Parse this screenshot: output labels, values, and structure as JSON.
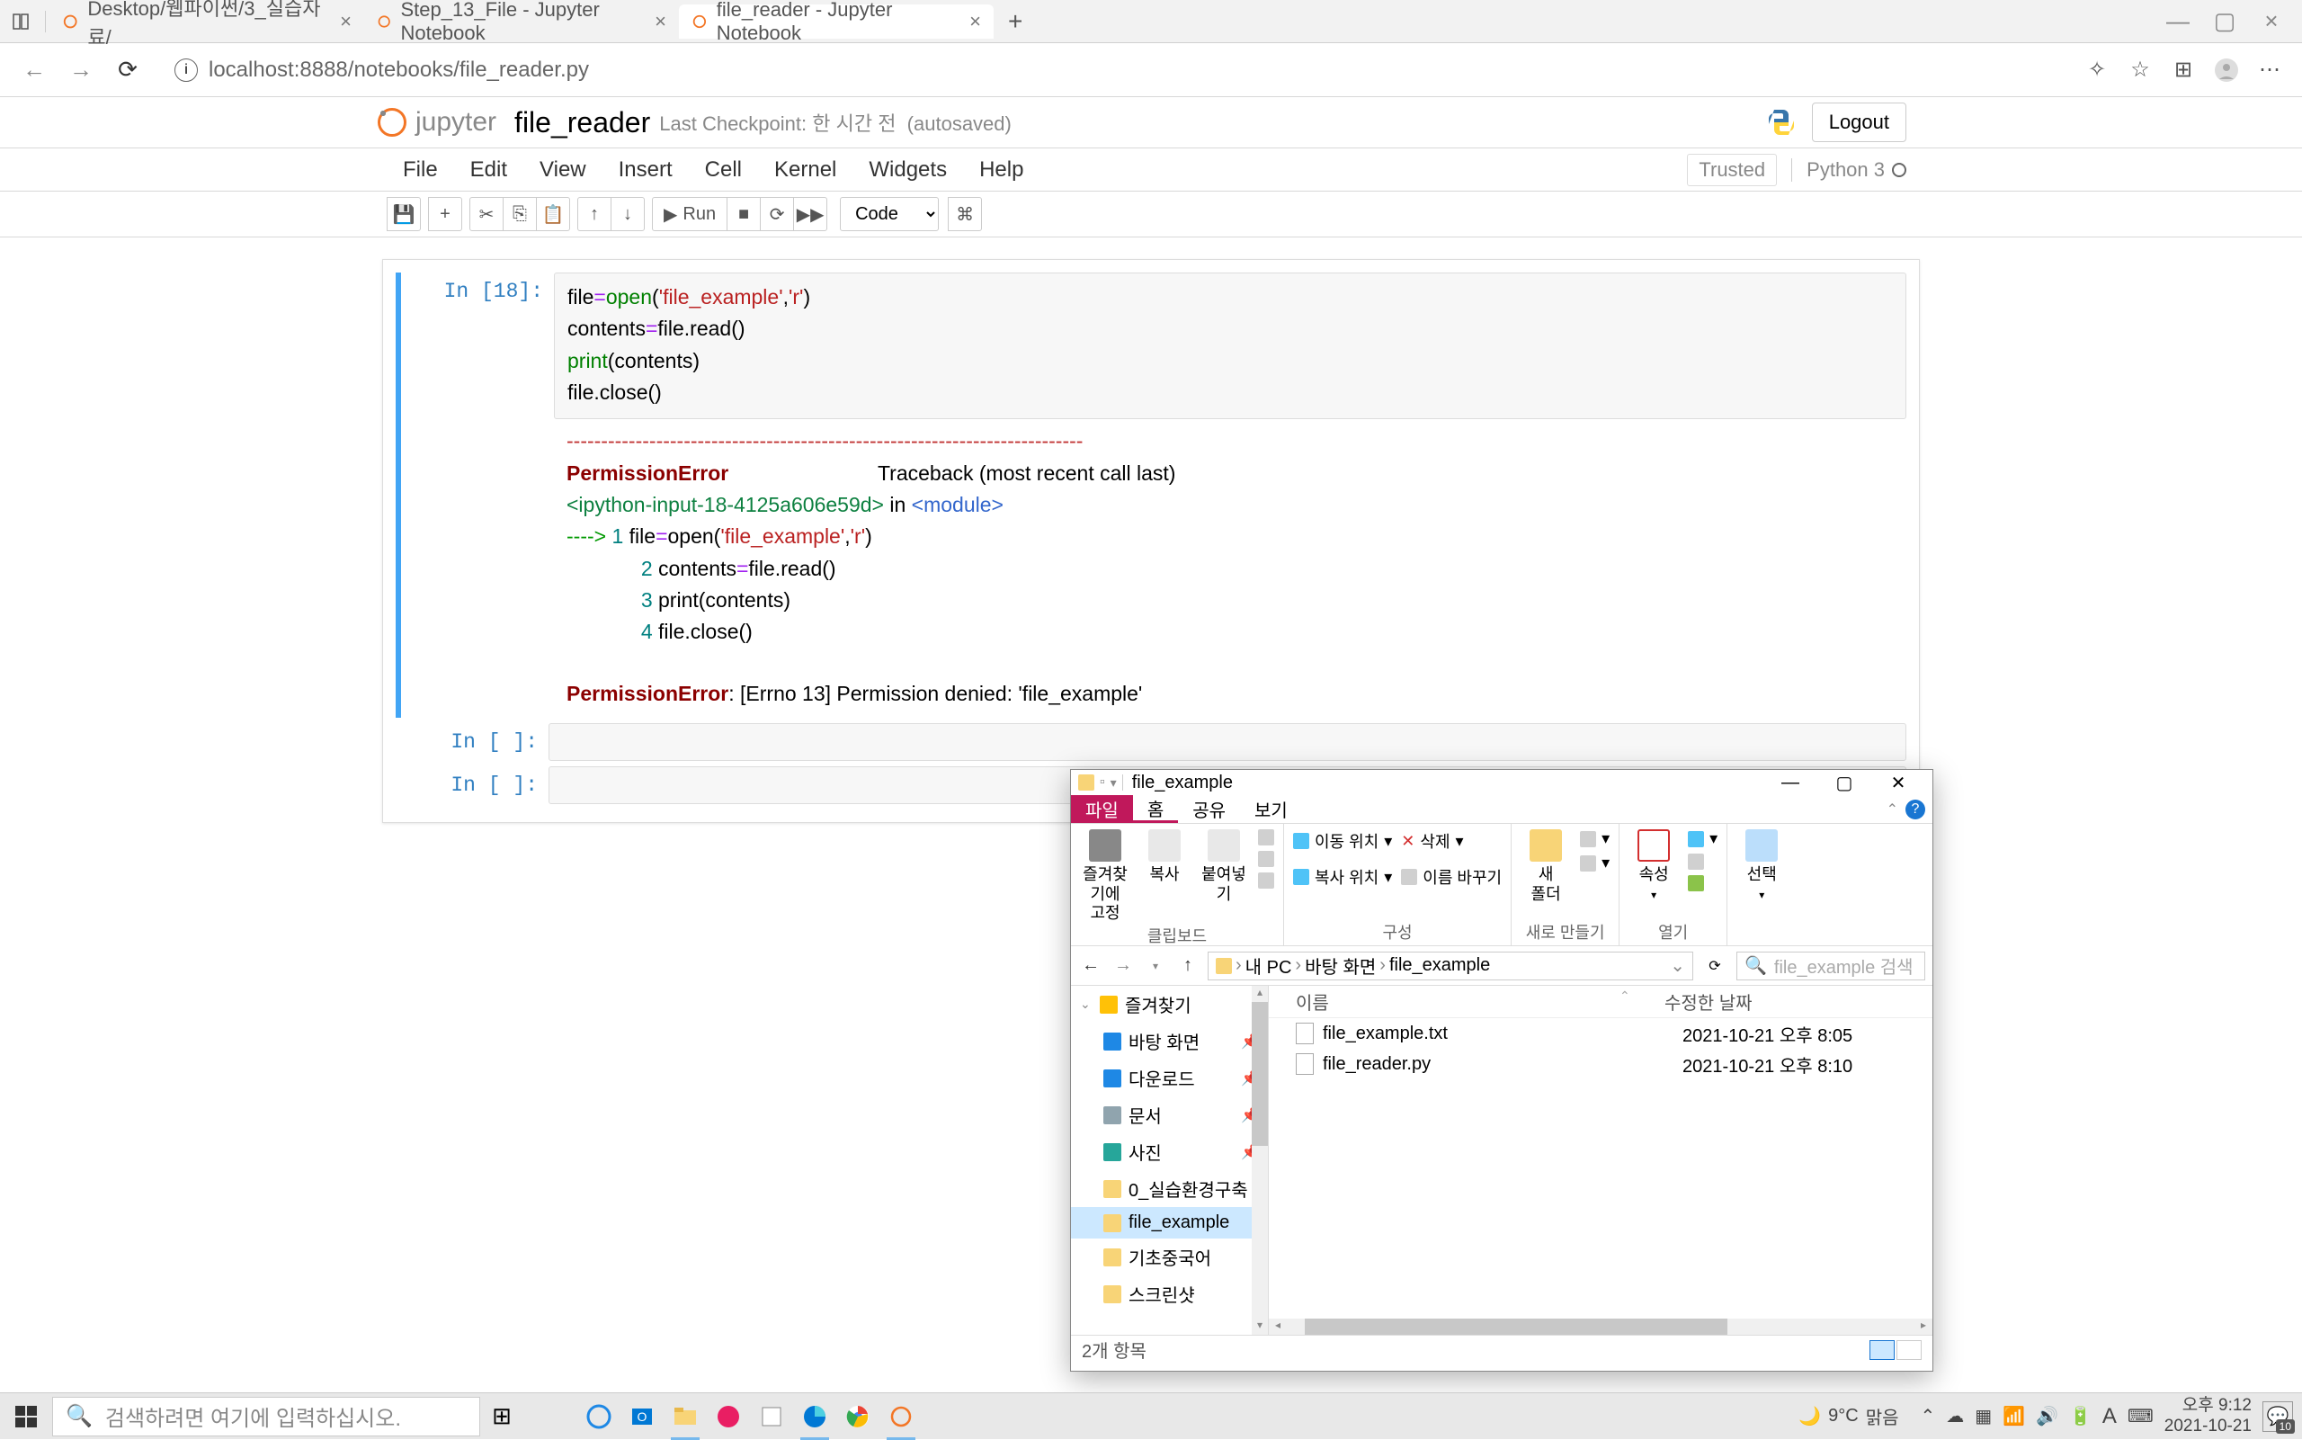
{
  "browser": {
    "tabs": [
      {
        "title": "Desktop/웹파이썬/3_실습자료/"
      },
      {
        "title": "Step_13_File - Jupyter Notebook"
      },
      {
        "title": "file_reader - Jupyter Notebook"
      }
    ],
    "url": "localhost:8888/notebooks/file_reader.py"
  },
  "jupyter": {
    "logo_text": "jupyter",
    "notebook_name": "file_reader",
    "checkpoint_prefix": "Last Checkpoint:",
    "checkpoint_time": "한 시간 전",
    "autosave": "(autosaved)",
    "logout": "Logout",
    "menu": [
      "File",
      "Edit",
      "View",
      "Insert",
      "Cell",
      "Kernel",
      "Widgets",
      "Help"
    ],
    "trusted": "Trusted",
    "kernel": "Python 3",
    "run": "Run",
    "cell_type": "Code"
  },
  "cells": {
    "prompt1": "In [18]:",
    "prompt2": "In [ ]:",
    "prompt3": "In [ ]:",
    "code": {
      "l1a": "file",
      "l1b": "=",
      "l1c": "open",
      "l1d": "(",
      "l1e": "'file_example'",
      "l1f": ",",
      "l1g": "'r'",
      "l1h": ")",
      "l2a": "contents",
      "l2b": "=",
      "l2c": "file.read()",
      "l3a": "print",
      "l3b": "(contents)",
      "l4": "file.close()"
    },
    "output": {
      "sep": "---------------------------------------------------------------------------",
      "err_name": "PermissionError",
      "traceback": "                          Traceback (most recent call last)",
      "ipython1": "<ipython-input-18-4125a606e59d>",
      "in": " in ",
      "module": "<module>",
      "arrow": "----> ",
      "n1": "1",
      "l1a": " file",
      "l1b": "=",
      "l1c": "open(",
      "l1d": "'file_example'",
      "l1e": ",",
      "l1f": "'r'",
      "l1g": ")",
      "n2": "2",
      "l2": " contents",
      "l2b": "=",
      "l2c": "file.read()",
      "n3": "3",
      "l3": " print(contents)",
      "n4": "4",
      "l4": " file.close()",
      "err_final": "PermissionError",
      "err_msg": ": [Errno 13] Permission denied: 'file_example'"
    }
  },
  "explorer": {
    "title": "file_example",
    "tabs": {
      "file": "파일",
      "home": "홈",
      "share": "공유",
      "view": "보기"
    },
    "ribbon": {
      "pin": "즐겨찾기에\n고정",
      "copy": "복사",
      "paste": "붙여넣기",
      "clipboard_label": "클립보드",
      "moveto": "이동 위치",
      "copyto": "복사 위치",
      "delete": "삭제",
      "rename": "이름 바꾸기",
      "organize_label": "구성",
      "newfolder": "새\n폴더",
      "new_label": "새로 만들기",
      "properties": "속성",
      "open_label": "열기",
      "select": "선택"
    },
    "breadcrumb": [
      "내 PC",
      "바탕 화면",
      "file_example"
    ],
    "search_placeholder": "file_example 검색",
    "sidebar": {
      "quickaccess": "즐겨찾기",
      "desktop": "바탕 화면",
      "downloads": "다운로드",
      "documents": "문서",
      "pictures": "사진",
      "folder0": "0_실습환경구축",
      "folder1": "file_example",
      "folder2": "기초중국어",
      "folder3": "스크린샷"
    },
    "columns": {
      "name": "이름",
      "date": "수정한 날짜"
    },
    "files": [
      {
        "name": "file_example.txt",
        "date": "2021-10-21 오후 8:05"
      },
      {
        "name": "file_reader.py",
        "date": "2021-10-21 오후 8:10"
      }
    ],
    "status": "2개 항목"
  },
  "taskbar": {
    "search_placeholder": "검색하려면 여기에 입력하십시오.",
    "weather_temp": "9°C",
    "weather_desc": "맑음",
    "time": "오후 9:12",
    "date": "2021-10-21",
    "notif_count": "10",
    "ime": "A"
  }
}
